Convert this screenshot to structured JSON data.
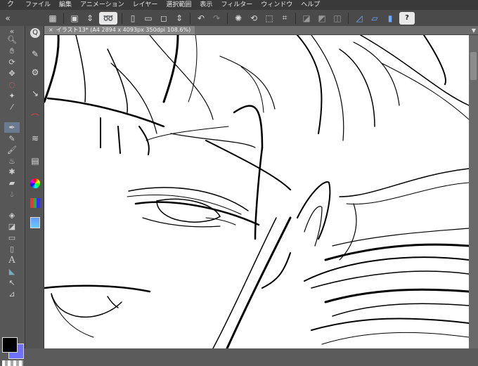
{
  "app": {
    "logo": "ク"
  },
  "menu": [
    "ファイル",
    "編集",
    "アニメーション",
    "レイヤー",
    "選択範囲",
    "表示",
    "フィルター",
    "ウィンドウ",
    "ヘルプ"
  ],
  "toolbar": {
    "icons": [
      "grid-icon",
      "new-file-icon",
      "spinner-icon",
      "lasso-icon",
      "page-icon",
      "folder-icon",
      "square-icon",
      "undo-icon",
      "redo-icon",
      "sparkle-icon",
      "transform-icon",
      "scale-icon",
      "crop-icon",
      "tint-icon",
      "gradient-icon",
      "pen-tilt-icon",
      "ruler-icon",
      "pen-pressure-icon",
      "help-icon"
    ],
    "help_label": "?"
  },
  "tab": {
    "title": "イラスト13* (A4 2894 x 4093px 350dpi 108.6%)",
    "close": "×"
  },
  "tools": {
    "text_tool_glyph": "A"
  },
  "colors": {
    "main": "#000000",
    "sub": "#7070ff",
    "accent": "#6b7a8f"
  }
}
